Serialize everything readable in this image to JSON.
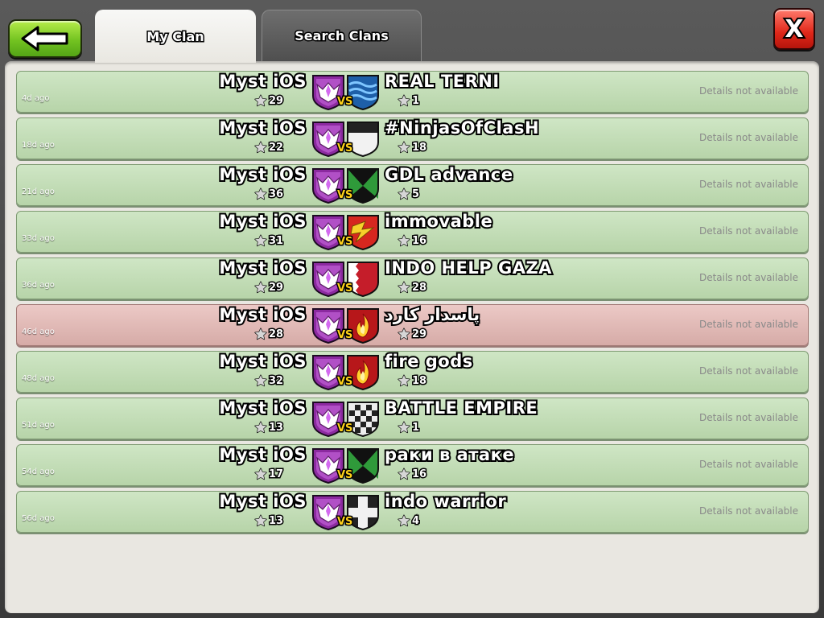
{
  "header": {
    "tabs": [
      {
        "label": "My Clan",
        "active": true
      },
      {
        "label": "Search Clans",
        "active": false
      }
    ],
    "back_icon": "arrow-left-icon",
    "close_label": "X"
  },
  "colors": {
    "win_row": "#c4dcb8",
    "loss_row": "#e0b7b3",
    "vs_text": "#ffd21a"
  },
  "war_log": {
    "vs_label": "VS",
    "details_text": "Details not available",
    "entries": [
      {
        "ago": "4d ago",
        "my_clan": "Myst iOS",
        "my_stars": "29",
        "enemy_clan": "REAL TERNI",
        "enemy_stars": "1",
        "result": "win",
        "enemy_badge": "waves-badge"
      },
      {
        "ago": "18d ago",
        "my_clan": "Myst iOS",
        "my_stars": "22",
        "enemy_clan": "#NinjasOfClasH",
        "enemy_stars": "18",
        "result": "win",
        "enemy_badge": "black-white-badge"
      },
      {
        "ago": "21d ago",
        "my_clan": "Myst iOS",
        "my_stars": "36",
        "enemy_clan": "GDL advance",
        "enemy_stars": "5",
        "result": "win",
        "enemy_badge": "green-black-badge"
      },
      {
        "ago": "33d ago",
        "my_clan": "Myst iOS",
        "my_stars": "31",
        "enemy_clan": "immovable",
        "enemy_stars": "16",
        "result": "win",
        "enemy_badge": "red-lightning-badge"
      },
      {
        "ago": "36d ago",
        "my_clan": "Myst iOS",
        "my_stars": "29",
        "enemy_clan": "INDO HELP GAZA",
        "enemy_stars": "28",
        "result": "win",
        "enemy_badge": "red-white-badge"
      },
      {
        "ago": "46d ago",
        "my_clan": "Myst iOS",
        "my_stars": "28",
        "enemy_clan": "پاسدار کارد",
        "enemy_stars": "29",
        "result": "loss",
        "enemy_badge": "red-fire-badge"
      },
      {
        "ago": "48d ago",
        "my_clan": "Myst iOS",
        "my_stars": "32",
        "enemy_clan": "fire gods",
        "enemy_stars": "18",
        "result": "win",
        "enemy_badge": "red-fire-badge"
      },
      {
        "ago": "51d ago",
        "my_clan": "Myst iOS",
        "my_stars": "13",
        "enemy_clan": "BATTLE EMPIRE",
        "enemy_stars": "1",
        "result": "win",
        "enemy_badge": "checker-badge"
      },
      {
        "ago": "54d ago",
        "my_clan": "Myst iOS",
        "my_stars": "17",
        "enemy_clan": "раки в атаке",
        "enemy_stars": "16",
        "result": "win",
        "enemy_badge": "green-black-badge"
      },
      {
        "ago": "56d ago",
        "my_clan": "Myst iOS",
        "my_stars": "13",
        "enemy_clan": "indo warrior",
        "enemy_stars": "4",
        "result": "win",
        "enemy_badge": "white-cross-badge"
      }
    ]
  }
}
